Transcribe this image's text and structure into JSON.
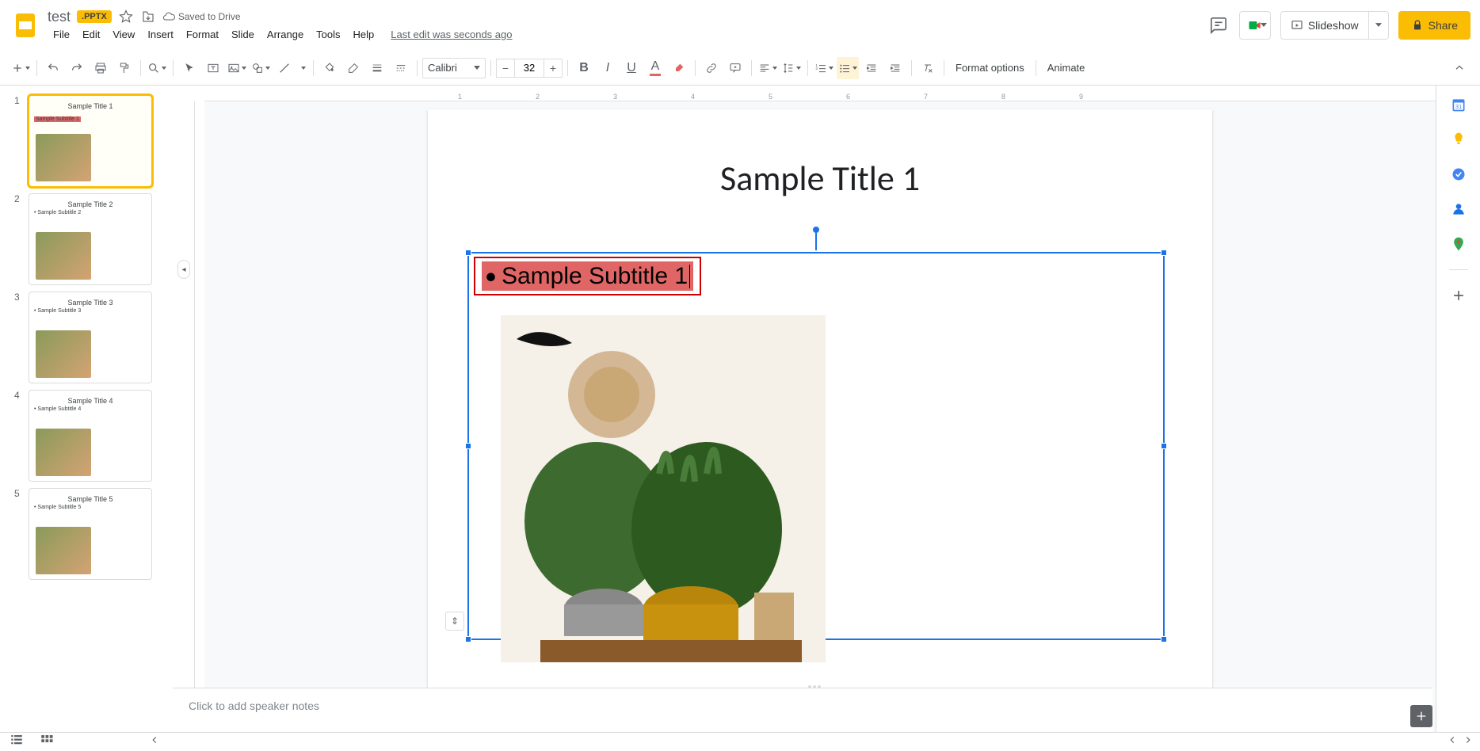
{
  "header": {
    "doc_title": "test",
    "badge": ".PPTX",
    "saved": "Saved to Drive",
    "last_edit": "Last edit was seconds ago",
    "slideshow": "Slideshow",
    "share": "Share"
  },
  "menus": [
    "File",
    "Edit",
    "View",
    "Insert",
    "Format",
    "Slide",
    "Arrange",
    "Tools",
    "Help"
  ],
  "toolbar": {
    "font": "Calibri",
    "size": "32",
    "format_options": "Format options",
    "animate": "Animate"
  },
  "slides": [
    {
      "num": "1",
      "title": "Sample Title 1",
      "subtitle": "Sample Subtitle 1",
      "selected": true,
      "highlight": true
    },
    {
      "num": "2",
      "title": "Sample Title 2",
      "subtitle": "• Sample Subtitle 2",
      "selected": false,
      "highlight": false
    },
    {
      "num": "3",
      "title": "Sample Title 3",
      "subtitle": "• Sample Subtitle 3",
      "selected": false,
      "highlight": false
    },
    {
      "num": "4",
      "title": "Sample Title 4",
      "subtitle": "• Sample Subtitle 4",
      "selected": false,
      "highlight": false
    },
    {
      "num": "5",
      "title": "Sample Title 5",
      "subtitle": "• Sample Subtitle 5",
      "selected": false,
      "highlight": false
    }
  ],
  "canvas": {
    "title": "Sample Title 1",
    "subtitle": "Sample Subtitle 1"
  },
  "notes": {
    "placeholder": "Click to add speaker notes"
  },
  "ruler_marks": [
    "1",
    "2",
    "3",
    "4",
    "5",
    "6",
    "7",
    "8",
    "9"
  ]
}
